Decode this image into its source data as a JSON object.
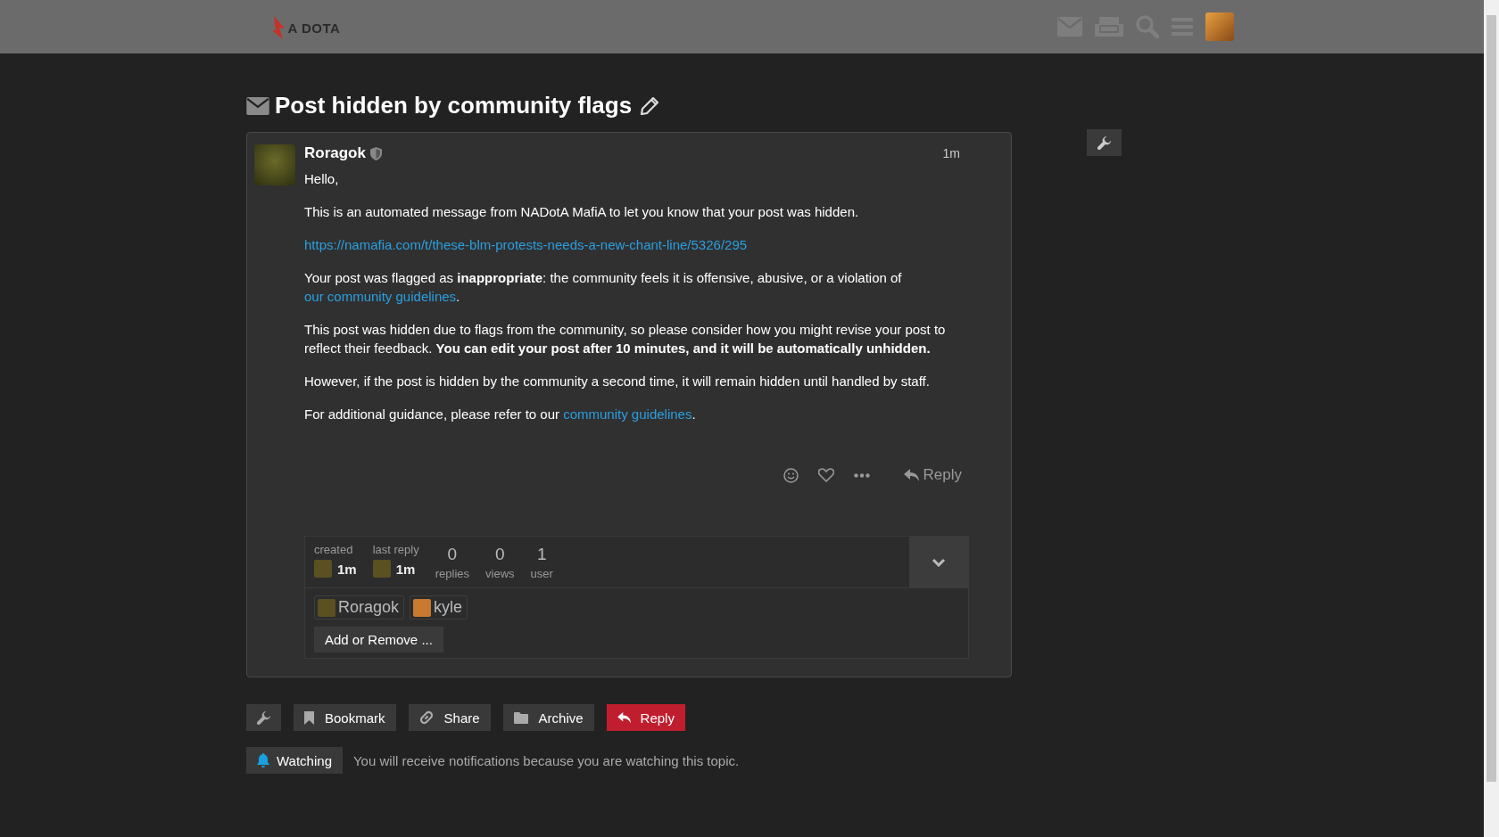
{
  "header": {
    "logo_text": "A DOTA"
  },
  "topic": {
    "title": "Post hidden by community flags",
    "is_private_message": true
  },
  "post": {
    "author": "Roragok",
    "author_is_moderator": true,
    "time": "1m",
    "paragraphs": [
      [
        {
          "kind": "text",
          "text": "Hello,"
        }
      ],
      [
        {
          "kind": "text",
          "text": "This is an automated message from NADotA MafiA to let you know that your post was hidden."
        }
      ],
      [
        {
          "kind": "link",
          "text": "https://namafia.com/t/these-blm-protests-needs-a-new-chant-line/5326/295"
        }
      ],
      [
        {
          "kind": "text",
          "text": "Your post was flagged as **inappropriate**: the community feels it is offensive, abusive, or a violation of"
        },
        {
          "kind": "link",
          "text": "our community guidelines"
        },
        {
          "kind": "text",
          "text": "."
        }
      ],
      [
        {
          "kind": "text",
          "text": "This post was hidden due to flags from the community, so please consider how you might revise your post to reflect their feedback. **You can edit your post after 10 minutes, and it will be automatically unhidden.**"
        }
      ],
      [
        {
          "kind": "text",
          "text": "However, if the post is hidden by the community a second time, it will remain hidden until handled by staff."
        }
      ],
      [
        {
          "kind": "text",
          "text": "For additional guidance, please refer to our"
        },
        {
          "kind": "link",
          "text": "community guidelines"
        },
        {
          "kind": "text",
          "text": "."
        }
      ]
    ],
    "reply_label": "Reply"
  },
  "topic_map": {
    "created": {
      "label": "created",
      "time": "1m"
    },
    "last_reply": {
      "label": "last reply",
      "time": "1m"
    },
    "stats": [
      {
        "value": "0",
        "label": "replies"
      },
      {
        "value": "0",
        "label": "views"
      },
      {
        "value": "1",
        "label": "user"
      }
    ],
    "expanded": true,
    "participants": [
      {
        "name": "Roragok",
        "color": "#5a5020"
      },
      {
        "name": "kyle",
        "color": "#c87a30"
      }
    ],
    "add_button": "Add or Remove ..."
  },
  "footer_buttons": [
    {
      "kind": "admin"
    },
    {
      "kind": "bookmark",
      "label": "Bookmark"
    },
    {
      "kind": "share",
      "label": "Share"
    },
    {
      "kind": "archive",
      "label": "Archive"
    },
    {
      "kind": "reply",
      "label": "Reply"
    }
  ],
  "notification": {
    "level": "Watching",
    "description": "You will receive notifications because you are watching this topic."
  }
}
